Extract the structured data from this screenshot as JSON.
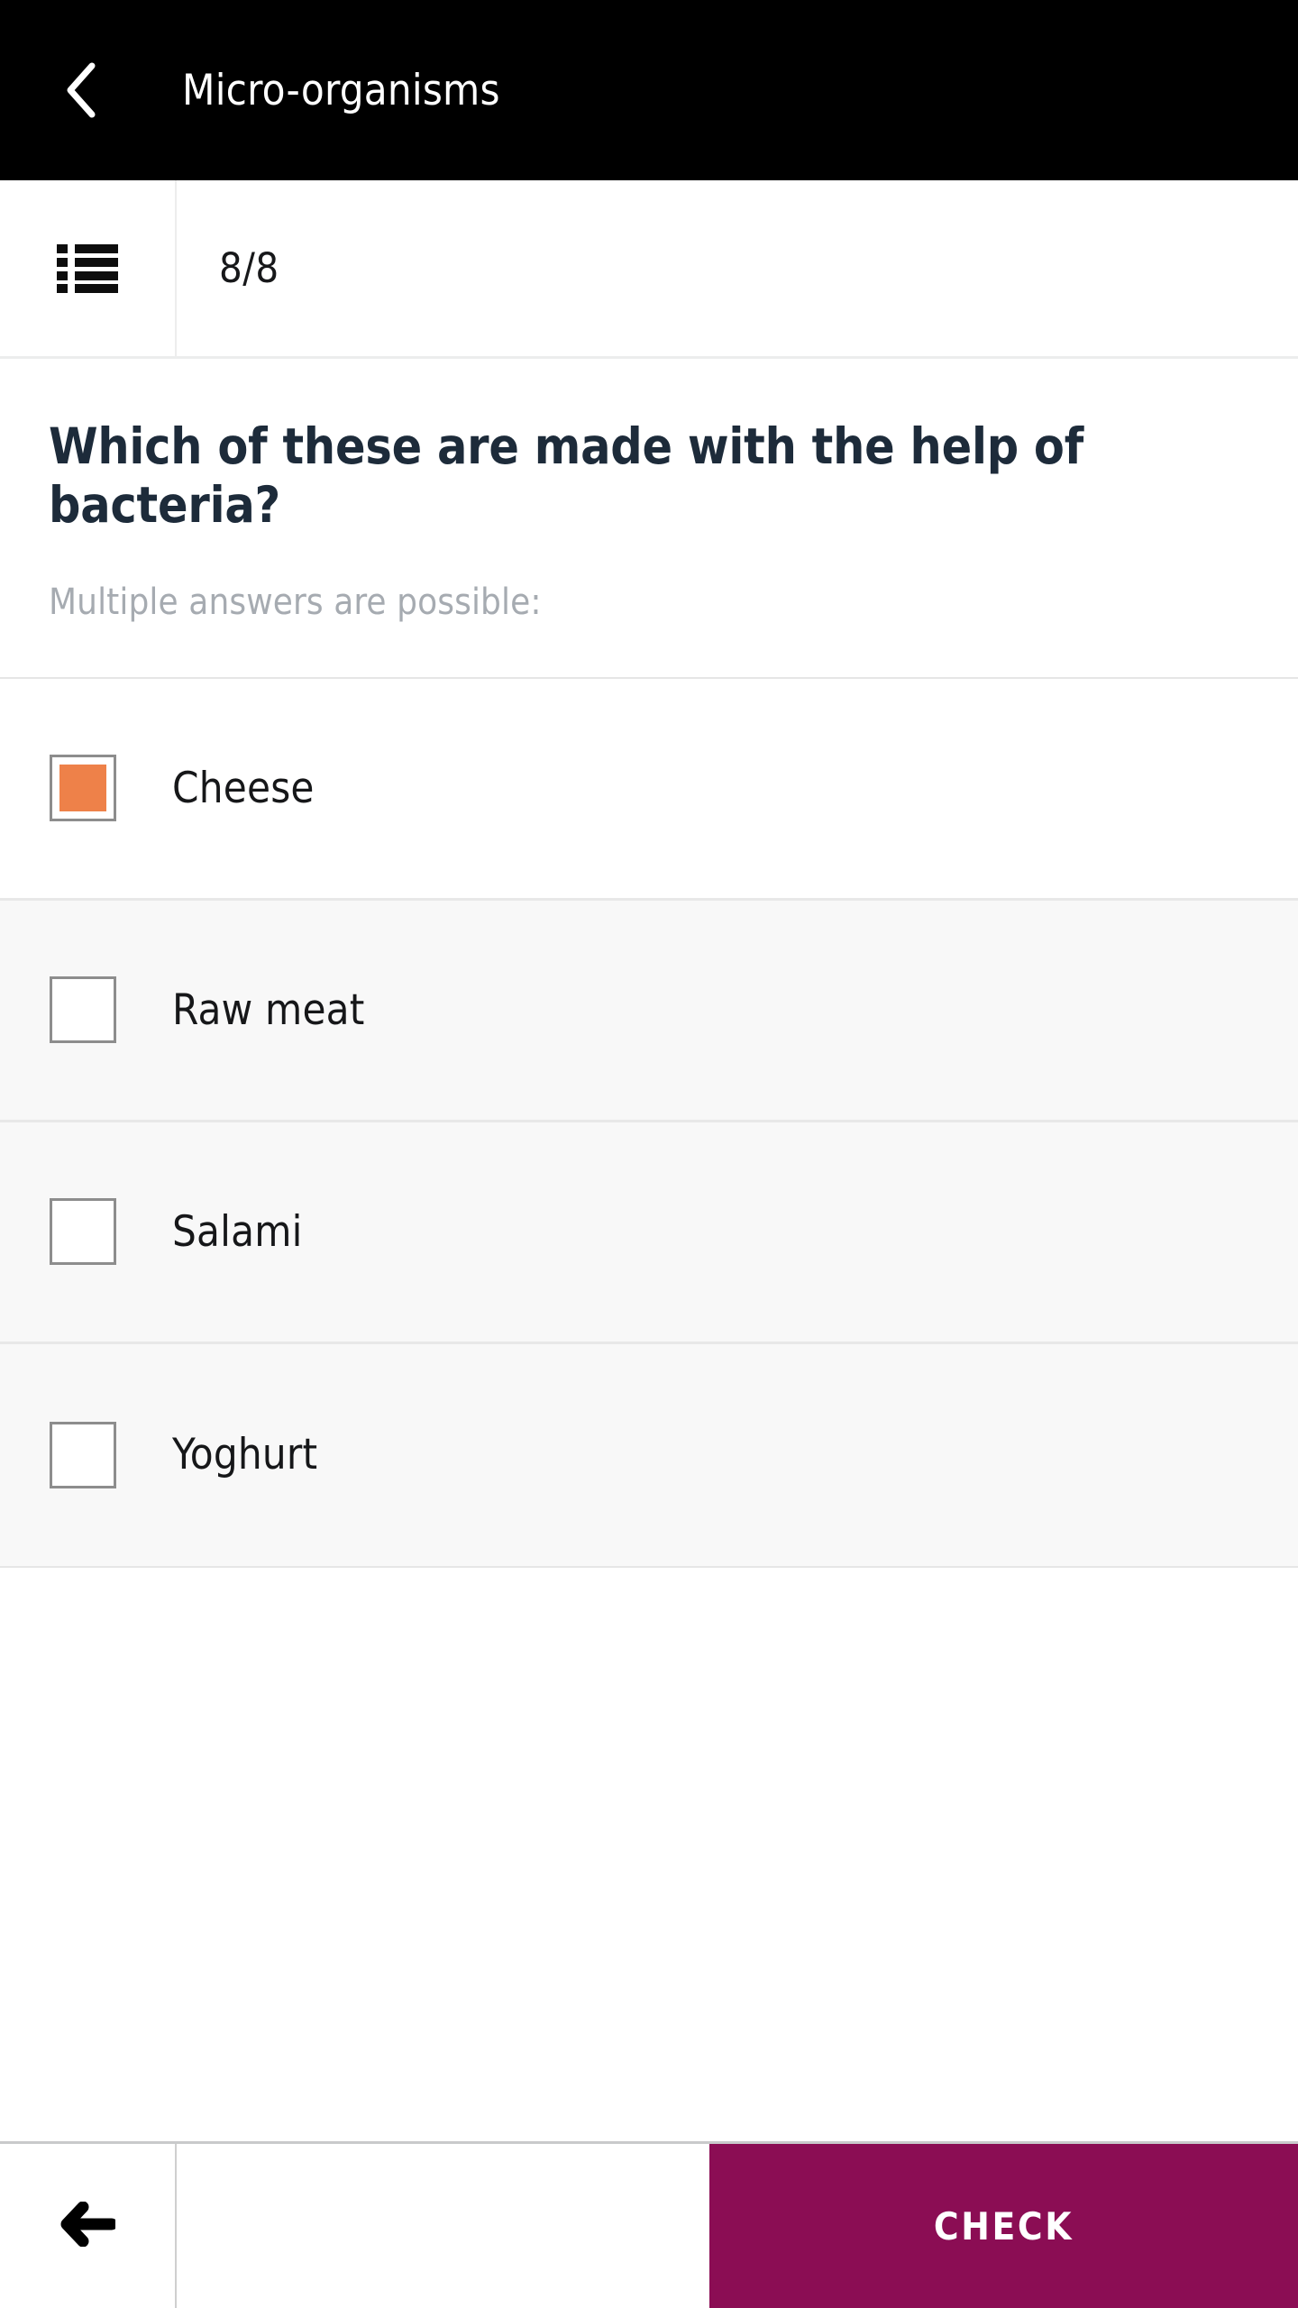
{
  "header": {
    "back_icon": "chevron-left-icon",
    "title": "Micro-organisms",
    "background_color": "#000000",
    "text_color": "#ffffff"
  },
  "toolbar": {
    "list_icon": "list-bullet-icon",
    "progress_label": "8/8",
    "current_question": 8,
    "total_questions": 8
  },
  "question": {
    "text": "Which of these are made with the help of bacteria?",
    "subtitle": "Multiple answers are possible:",
    "title_color": "#1d2b3a",
    "subtitle_color": "#a6abb1"
  },
  "answers": {
    "selected_fill_color": "#ee8149",
    "options": [
      {
        "label": "Cheese",
        "checked": true,
        "checkbox_icon": "checkbox-checked-icon"
      },
      {
        "label": "Raw meat",
        "checked": false,
        "checkbox_icon": "checkbox-unchecked-icon"
      },
      {
        "label": "Salami",
        "checked": false,
        "checkbox_icon": "checkbox-unchecked-icon"
      },
      {
        "label": "Yoghurt",
        "checked": false,
        "checkbox_icon": "checkbox-unchecked-icon"
      }
    ]
  },
  "bottombar": {
    "back_icon": "arrow-left-icon",
    "check_label": "CHECK",
    "check_color": "#8b0d54"
  }
}
